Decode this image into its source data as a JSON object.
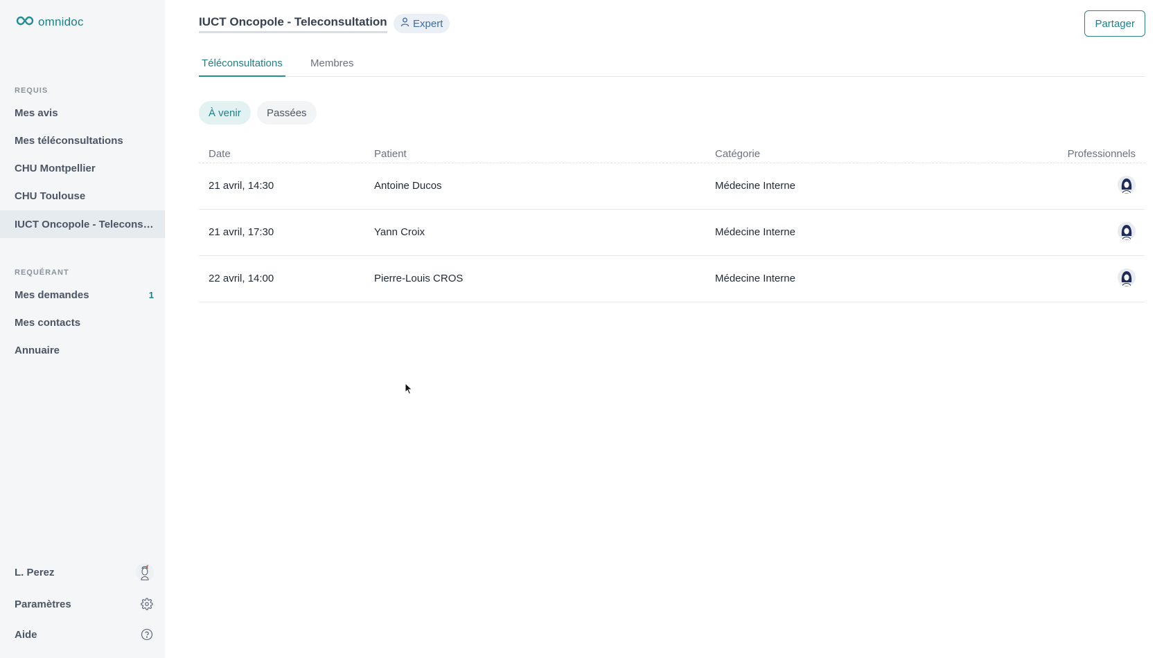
{
  "brand": {
    "name": "omnidoc",
    "accent": "#1f7f86"
  },
  "sidebar": {
    "requis_title": "REQUIS",
    "requis_items": [
      {
        "label": "Mes avis"
      },
      {
        "label": "Mes téléconsultations"
      },
      {
        "label": "CHU Montpellier"
      },
      {
        "label": "CHU Toulouse"
      },
      {
        "label": "IUCT Oncopole - Teleconsultation"
      }
    ],
    "requerant_title": "REQUÉRANT",
    "requerant_items": [
      {
        "label": "Mes demandes",
        "badge": "1"
      },
      {
        "label": "Mes contacts"
      },
      {
        "label": "Annuaire"
      }
    ],
    "user": {
      "name": "L. Perez"
    },
    "settings_label": "Paramètres",
    "help_label": "Aide"
  },
  "header": {
    "title": "IUCT Oncopole - Teleconsultation",
    "role_badge": "Expert",
    "share_label": "Partager"
  },
  "tabs": [
    {
      "label": "Téléconsultations",
      "active": true
    },
    {
      "label": "Membres",
      "active": false
    }
  ],
  "filters": [
    {
      "label": "À venir",
      "active": true
    },
    {
      "label": "Passées",
      "active": false
    }
  ],
  "table": {
    "columns": [
      "Date",
      "Patient",
      "Catégorie",
      "Professionnels"
    ],
    "rows": [
      {
        "date": "21 avril, 14:30",
        "patient": "Antoine Ducos",
        "category": "Médecine Interne"
      },
      {
        "date": "21 avril, 17:30",
        "patient": "Yann Croix",
        "category": "Médecine Interne"
      },
      {
        "date": "22 avril, 14:00",
        "patient": "Pierre-Louis CROS",
        "category": "Médecine Interne"
      }
    ]
  }
}
